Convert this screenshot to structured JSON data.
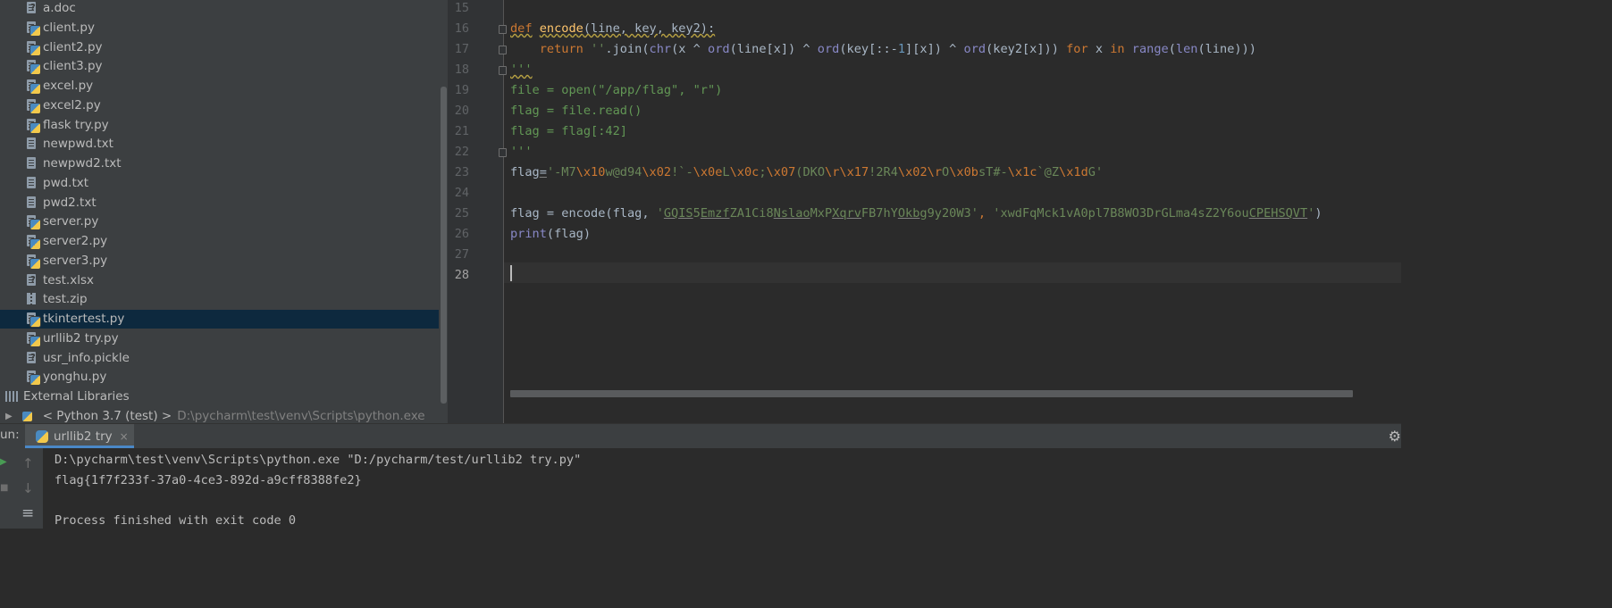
{
  "project_tree": {
    "files": [
      {
        "name": "a.doc",
        "icon": "doc-file-icon"
      },
      {
        "name": "client.py",
        "icon": "python-file-icon"
      },
      {
        "name": "client2.py",
        "icon": "python-file-icon"
      },
      {
        "name": "client3.py",
        "icon": "python-file-icon"
      },
      {
        "name": "excel.py",
        "icon": "python-file-icon"
      },
      {
        "name": "excel2.py",
        "icon": "python-file-icon"
      },
      {
        "name": "flask try.py",
        "icon": "python-file-icon"
      },
      {
        "name": "newpwd.txt",
        "icon": "text-file-icon"
      },
      {
        "name": "newpwd2.txt",
        "icon": "text-file-icon"
      },
      {
        "name": "pwd.txt",
        "icon": "text-file-icon"
      },
      {
        "name": "pwd2.txt",
        "icon": "text-file-icon"
      },
      {
        "name": "server.py",
        "icon": "python-file-icon"
      },
      {
        "name": "server2.py",
        "icon": "python-file-icon"
      },
      {
        "name": "server3.py",
        "icon": "python-file-icon"
      },
      {
        "name": "test.xlsx",
        "icon": "unknown-file-icon"
      },
      {
        "name": "test.zip",
        "icon": "zip-file-icon"
      },
      {
        "name": "tkintertest.py",
        "icon": "python-file-icon",
        "selected": true
      },
      {
        "name": "urllib2 try.py",
        "icon": "python-file-icon"
      },
      {
        "name": "usr_info.pickle",
        "icon": "unknown-file-icon"
      },
      {
        "name": "yonghu.py",
        "icon": "python-file-icon"
      }
    ],
    "external_libraries_label": "External Libraries",
    "interpreter": {
      "name": "< Python 3.7 (test) >",
      "path": "D:\\pycharm\\test\\venv\\Scripts\\python.exe"
    }
  },
  "editor": {
    "line_numbers": [
      "15",
      "16",
      "17",
      "18",
      "19",
      "20",
      "21",
      "22",
      "23",
      "24",
      "25",
      "26",
      "27",
      "28"
    ],
    "current_line": "28",
    "code": {
      "l16": {
        "kw": "def",
        "fn": "encode",
        "rest": "(line, key, key2):"
      },
      "l17": {
        "indent": "    ",
        "kw_return": "return",
        "s_empty": "''",
        "join": ".join(",
        "bi_chr": "chr",
        "a1": "(x ^ ",
        "bi_ord1": "ord",
        "a2": "(line[x]) ^ ",
        "bi_ord2": "ord",
        "a3": "(key[::-",
        "num1": "1",
        "a4": "][x]) ^ ",
        "bi_ord3": "ord",
        "a5": "(key2[x])) ",
        "kw_for": "for",
        "a6": " x ",
        "kw_in": "in",
        "a7": " ",
        "bi_range": "range",
        "a8": "(",
        "bi_len": "len",
        "a9": "(line)))"
      },
      "l18": "'''",
      "l19": "file = open(\"/app/flag\", \"r\")",
      "l20": "flag = file.read()",
      "l21": "flag = flag[:42]",
      "l22": "'''",
      "l23": {
        "var": "flag",
        "eq": "=",
        "parts": [
          {
            "t": "'-M7",
            "c": "st"
          },
          {
            "t": "\\x10",
            "c": "esc"
          },
          {
            "t": "w@d94",
            "c": "st"
          },
          {
            "t": "\\x02",
            "c": "esc"
          },
          {
            "t": "!`-",
            "c": "st"
          },
          {
            "t": "\\x0e",
            "c": "esc"
          },
          {
            "t": "L",
            "c": "st"
          },
          {
            "t": "\\x0c",
            "c": "esc"
          },
          {
            "t": ";",
            "c": "st"
          },
          {
            "t": "\\x07",
            "c": "esc"
          },
          {
            "t": "(DKO",
            "c": "st"
          },
          {
            "t": "\\r\\x17",
            "c": "esc"
          },
          {
            "t": "!2R4",
            "c": "st"
          },
          {
            "t": "\\x02\\r",
            "c": "esc"
          },
          {
            "t": "O",
            "c": "st"
          },
          {
            "t": "\\x0b",
            "c": "esc"
          },
          {
            "t": "sT#-",
            "c": "st"
          },
          {
            "t": "\\x1c",
            "c": "esc"
          },
          {
            "t": "`@Z",
            "c": "st"
          },
          {
            "t": "\\x1d",
            "c": "esc"
          },
          {
            "t": "G'",
            "c": "st"
          }
        ]
      },
      "l25": {
        "pre": "flag = encode(flag, ",
        "q1": "'",
        "k1a": "GQIS",
        "k1b": "5",
        "k1c": "Emzf",
        "k1d": "ZA1Ci8",
        "k1e": "Nslao",
        "k1f": "MxP",
        "k1g": "Xqrv",
        "k1h": "FB7hY",
        "k1i": "Okbg",
        "k1j": "9y20W3",
        "q2": "'",
        "sep": ", ",
        "q3": "'",
        "k2a": "xwdFqMck1vA0pl7B8WO3DrGLma4sZ2Y6ou",
        "k2b": "CPEHSQVT",
        "q4": "'",
        "post": ")"
      },
      "l26": {
        "bi": "print",
        "rest": "(flag)"
      }
    }
  },
  "run_panel": {
    "label": "un:",
    "tab_title": "urllib2 try",
    "tab_close": "×",
    "console_lines": [
      "D:\\pycharm\\test\\venv\\Scripts\\python.exe \"D:/pycharm/test/urllib2 try.py\"",
      "flag{1f7f233f-37a0-4ce3-892d-a9cff8388fe2}",
      "",
      "Process finished with exit code 0"
    ]
  },
  "icons": {
    "run": "▶",
    "stop": "■",
    "up": "↑",
    "down": "↓",
    "wrap": "≡",
    "gear": "⚙",
    "expand": "▶"
  },
  "colors": {
    "panel_bg": "#3c3f41",
    "editor_bg": "#2b2b2b",
    "keyword": "#cc7832",
    "string": "#6a8759",
    "function": "#ffc66d",
    "builtin": "#8888c6",
    "number": "#6897bb",
    "selection": "#0d293e",
    "accent": "#4a88c7"
  }
}
